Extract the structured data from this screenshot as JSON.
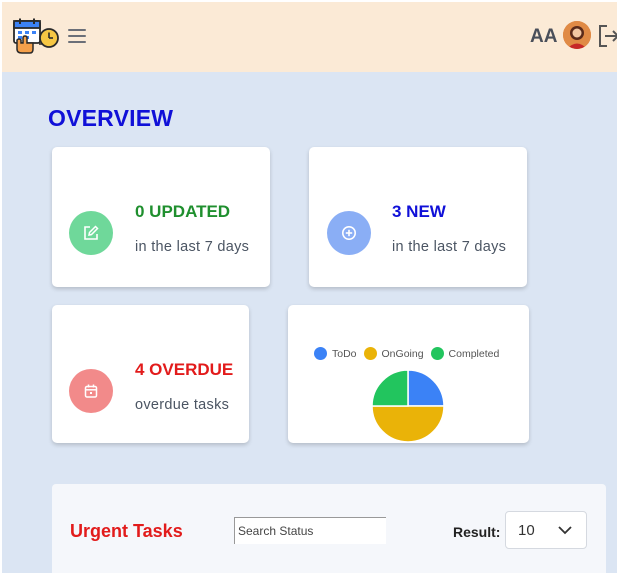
{
  "header": {
    "initials": "AA",
    "icons": {
      "logo": "calendar-clock-logo",
      "menu": "hamburger-menu-icon",
      "avatar": "user-avatar",
      "logout": "logout-icon"
    }
  },
  "overview": {
    "title": "OVERVIEW",
    "cards": [
      {
        "value": "0 UPDATED",
        "desc": "in the last 7 days",
        "icon": "edit-icon",
        "color": "#1f8f2e",
        "icon_bg": "#6fd89a"
      },
      {
        "value": "3 NEW",
        "desc": "in the last 7 days",
        "icon": "plus-circle-icon",
        "color": "#1010d8",
        "icon_bg": "#8aaef5"
      },
      {
        "value": "4 OVERDUE",
        "desc": "overdue tasks",
        "icon": "calendar-icon",
        "color": "#e21b1b",
        "icon_bg": "#f28a8a"
      }
    ]
  },
  "chart_data": {
    "type": "pie",
    "title": "",
    "legend_position": "top",
    "categories": [
      "ToDo",
      "OnGoing",
      "Completed"
    ],
    "values": [
      1,
      2,
      1
    ],
    "colors": [
      "#3b82f6",
      "#eab308",
      "#22c55e"
    ]
  },
  "urgent": {
    "title": "Urgent Tasks",
    "search_placeholder": "Search Status",
    "result_label": "Result:",
    "result_value": "10"
  }
}
